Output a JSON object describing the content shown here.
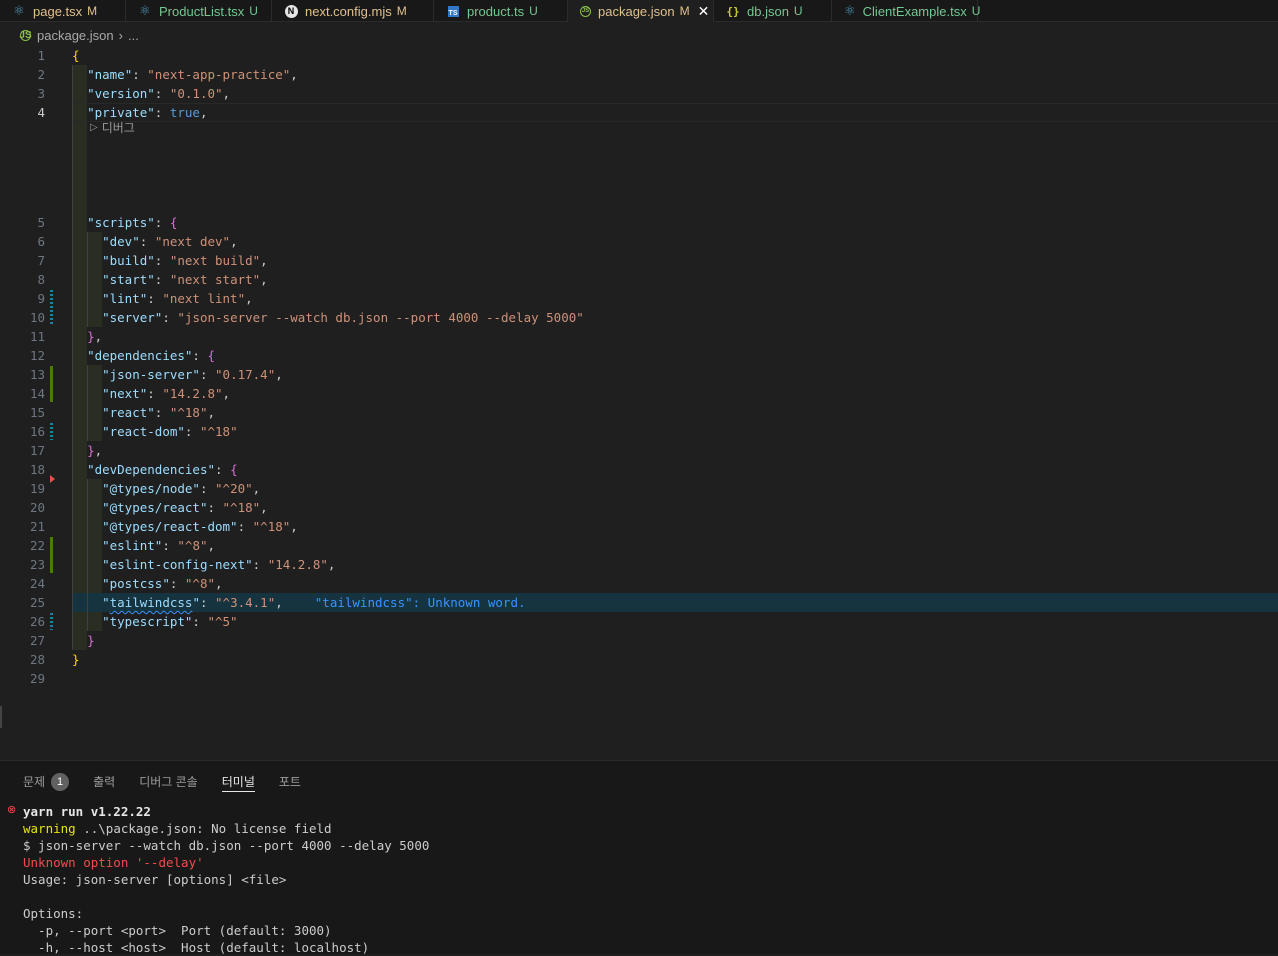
{
  "tabs": [
    {
      "name": "page.tsx",
      "status": "M",
      "icon": "react-icon"
    },
    {
      "name": "ProductList.tsx",
      "status": "U",
      "icon": "react-icon"
    },
    {
      "name": "next.config.mjs",
      "status": "M",
      "icon": "nextjs-icon"
    },
    {
      "name": "product.ts",
      "status": "U",
      "icon": "typescript-icon"
    },
    {
      "name": "package.json",
      "status": "M",
      "icon": "nodejs-icon",
      "active": true,
      "close": "✕"
    },
    {
      "name": "db.json",
      "status": "U",
      "icon": "json-icon"
    },
    {
      "name": "ClientExample.tsx",
      "status": "U",
      "icon": "react-icon"
    }
  ],
  "breadcrumb": {
    "file": "package.json",
    "separator": "›",
    "more": "..."
  },
  "editor": {
    "current_line": 4,
    "codelens_label": "디버그",
    "diagnostic_message": "\"tailwindcss\": Unknown word.",
    "line_numbers": [
      "1",
      "2",
      "3",
      "4",
      "5",
      "6",
      "7",
      "8",
      "9",
      "10",
      "11",
      "12",
      "13",
      "14",
      "15",
      "16",
      "17",
      "18",
      "19",
      "20",
      "21",
      "22",
      "23",
      "24",
      "25",
      "26",
      "27",
      "28",
      "29"
    ],
    "lines": [
      [
        {
          "t": "{",
          "c": "b1"
        }
      ],
      [
        {
          "t": "  "
        },
        {
          "t": "\"name\"",
          "c": "k"
        },
        {
          "t": ": ",
          "c": "p"
        },
        {
          "t": "\"next-app-practice\"",
          "c": "s"
        },
        {
          "t": ",",
          "c": "p"
        }
      ],
      [
        {
          "t": "  "
        },
        {
          "t": "\"version\"",
          "c": "k"
        },
        {
          "t": ": ",
          "c": "p"
        },
        {
          "t": "\"0.1.0\"",
          "c": "s"
        },
        {
          "t": ",",
          "c": "p"
        }
      ],
      [
        {
          "t": "  "
        },
        {
          "t": "\"private\"",
          "c": "k"
        },
        {
          "t": ": ",
          "c": "p"
        },
        {
          "t": "true",
          "c": "kw"
        },
        {
          "t": ",",
          "c": "p"
        }
      ],
      [
        {
          "t": "  "
        },
        {
          "t": "\"scripts\"",
          "c": "k"
        },
        {
          "t": ": ",
          "c": "p"
        },
        {
          "t": "{",
          "c": "b2"
        }
      ],
      [
        {
          "t": "    "
        },
        {
          "t": "\"dev\"",
          "c": "k"
        },
        {
          "t": ": ",
          "c": "p"
        },
        {
          "t": "\"next dev\"",
          "c": "s"
        },
        {
          "t": ",",
          "c": "p"
        }
      ],
      [
        {
          "t": "    "
        },
        {
          "t": "\"build\"",
          "c": "k"
        },
        {
          "t": ": ",
          "c": "p"
        },
        {
          "t": "\"next build\"",
          "c": "s"
        },
        {
          "t": ",",
          "c": "p"
        }
      ],
      [
        {
          "t": "    "
        },
        {
          "t": "\"start\"",
          "c": "k"
        },
        {
          "t": ": ",
          "c": "p"
        },
        {
          "t": "\"next start\"",
          "c": "s"
        },
        {
          "t": ",",
          "c": "p"
        }
      ],
      [
        {
          "t": "    "
        },
        {
          "t": "\"lint\"",
          "c": "k"
        },
        {
          "t": ": ",
          "c": "p"
        },
        {
          "t": "\"next lint\"",
          "c": "s"
        },
        {
          "t": ",",
          "c": "p"
        }
      ],
      [
        {
          "t": "    "
        },
        {
          "t": "\"server\"",
          "c": "k"
        },
        {
          "t": ": ",
          "c": "p"
        },
        {
          "t": "\"json-server --watch db.json --port 4000 --delay 5000\"",
          "c": "s"
        }
      ],
      [
        {
          "t": "  "
        },
        {
          "t": "}",
          "c": "b2"
        },
        {
          "t": ",",
          "c": "p"
        }
      ],
      [
        {
          "t": "  "
        },
        {
          "t": "\"dependencies\"",
          "c": "k"
        },
        {
          "t": ": ",
          "c": "p"
        },
        {
          "t": "{",
          "c": "b2"
        }
      ],
      [
        {
          "t": "    "
        },
        {
          "t": "\"json-server\"",
          "c": "k"
        },
        {
          "t": ": ",
          "c": "p"
        },
        {
          "t": "\"0.17.4\"",
          "c": "s"
        },
        {
          "t": ",",
          "c": "p"
        }
      ],
      [
        {
          "t": "    "
        },
        {
          "t": "\"next\"",
          "c": "k"
        },
        {
          "t": ": ",
          "c": "p"
        },
        {
          "t": "\"14.2.8\"",
          "c": "s"
        },
        {
          "t": ",",
          "c": "p"
        }
      ],
      [
        {
          "t": "    "
        },
        {
          "t": "\"react\"",
          "c": "k"
        },
        {
          "t": ": ",
          "c": "p"
        },
        {
          "t": "\"^18\"",
          "c": "s"
        },
        {
          "t": ",",
          "c": "p"
        }
      ],
      [
        {
          "t": "    "
        },
        {
          "t": "\"react-dom\"",
          "c": "k"
        },
        {
          "t": ": ",
          "c": "p"
        },
        {
          "t": "\"^18\"",
          "c": "s"
        }
      ],
      [
        {
          "t": "  "
        },
        {
          "t": "}",
          "c": "b2"
        },
        {
          "t": ",",
          "c": "p"
        }
      ],
      [
        {
          "t": "  "
        },
        {
          "t": "\"devDependencies\"",
          "c": "k"
        },
        {
          "t": ": ",
          "c": "p"
        },
        {
          "t": "{",
          "c": "b2"
        }
      ],
      [
        {
          "t": "    "
        },
        {
          "t": "\"@types/node\"",
          "c": "k"
        },
        {
          "t": ": ",
          "c": "p"
        },
        {
          "t": "\"^20\"",
          "c": "s"
        },
        {
          "t": ",",
          "c": "p"
        }
      ],
      [
        {
          "t": "    "
        },
        {
          "t": "\"@types/react\"",
          "c": "k"
        },
        {
          "t": ": ",
          "c": "p"
        },
        {
          "t": "\"^18\"",
          "c": "s"
        },
        {
          "t": ",",
          "c": "p"
        }
      ],
      [
        {
          "t": "    "
        },
        {
          "t": "\"@types/react-dom\"",
          "c": "k"
        },
        {
          "t": ": ",
          "c": "p"
        },
        {
          "t": "\"^18\"",
          "c": "s"
        },
        {
          "t": ",",
          "c": "p"
        }
      ],
      [
        {
          "t": "    "
        },
        {
          "t": "\"eslint\"",
          "c": "k"
        },
        {
          "t": ": ",
          "c": "p"
        },
        {
          "t": "\"^8\"",
          "c": "s"
        },
        {
          "t": ",",
          "c": "p"
        }
      ],
      [
        {
          "t": "    "
        },
        {
          "t": "\"eslint-config-next\"",
          "c": "k"
        },
        {
          "t": ": ",
          "c": "p"
        },
        {
          "t": "\"14.2.8\"",
          "c": "s"
        },
        {
          "t": ",",
          "c": "p"
        }
      ],
      [
        {
          "t": "    "
        },
        {
          "t": "\"postcss\"",
          "c": "k"
        },
        {
          "t": ": ",
          "c": "p"
        },
        {
          "t": "\"^8\"",
          "c": "s"
        },
        {
          "t": ",",
          "c": "p"
        }
      ],
      [
        {
          "t": "    "
        },
        {
          "t": "\"",
          "c": "k"
        },
        {
          "t": "tailwindcss",
          "c": "k squig"
        },
        {
          "t": "\"",
          "c": "k"
        },
        {
          "t": ": ",
          "c": "p"
        },
        {
          "t": "\"^3.4.1\"",
          "c": "s"
        },
        {
          "t": ",",
          "c": "p"
        }
      ],
      [
        {
          "t": "    "
        },
        {
          "t": "\"typescript\"",
          "c": "k"
        },
        {
          "t": ": ",
          "c": "p"
        },
        {
          "t": "\"^5\"",
          "c": "s"
        }
      ],
      [
        {
          "t": "  "
        },
        {
          "t": "}",
          "c": "b2"
        }
      ],
      [
        {
          "t": "}",
          "c": "b1"
        }
      ],
      []
    ]
  },
  "panel": {
    "tabs": [
      {
        "label": "문제",
        "badge": "1"
      },
      {
        "label": "출력"
      },
      {
        "label": "디버그 콘솔"
      },
      {
        "label": "터미널",
        "active": true
      },
      {
        "label": "포트"
      }
    ],
    "terminal": [
      {
        "text": "yarn run v1.22.22",
        "style": "bold",
        "error_dot": "⊗"
      },
      {
        "text": "warning",
        "style": "warn",
        "rest": " ..\\package.json: No license field"
      },
      {
        "text": "$ json-server --watch db.json --port 4000 --delay 5000"
      },
      {
        "text": "Unknown option '--delay'",
        "style": "err"
      },
      {
        "text": "Usage: json-server [options] <file>"
      },
      {
        "text": ""
      },
      {
        "text": "Options:"
      },
      {
        "text": "  -p, --port <port>  Port (default: 3000)"
      },
      {
        "text": "  -h, --host <host>  Host (default: localhost)"
      }
    ]
  }
}
